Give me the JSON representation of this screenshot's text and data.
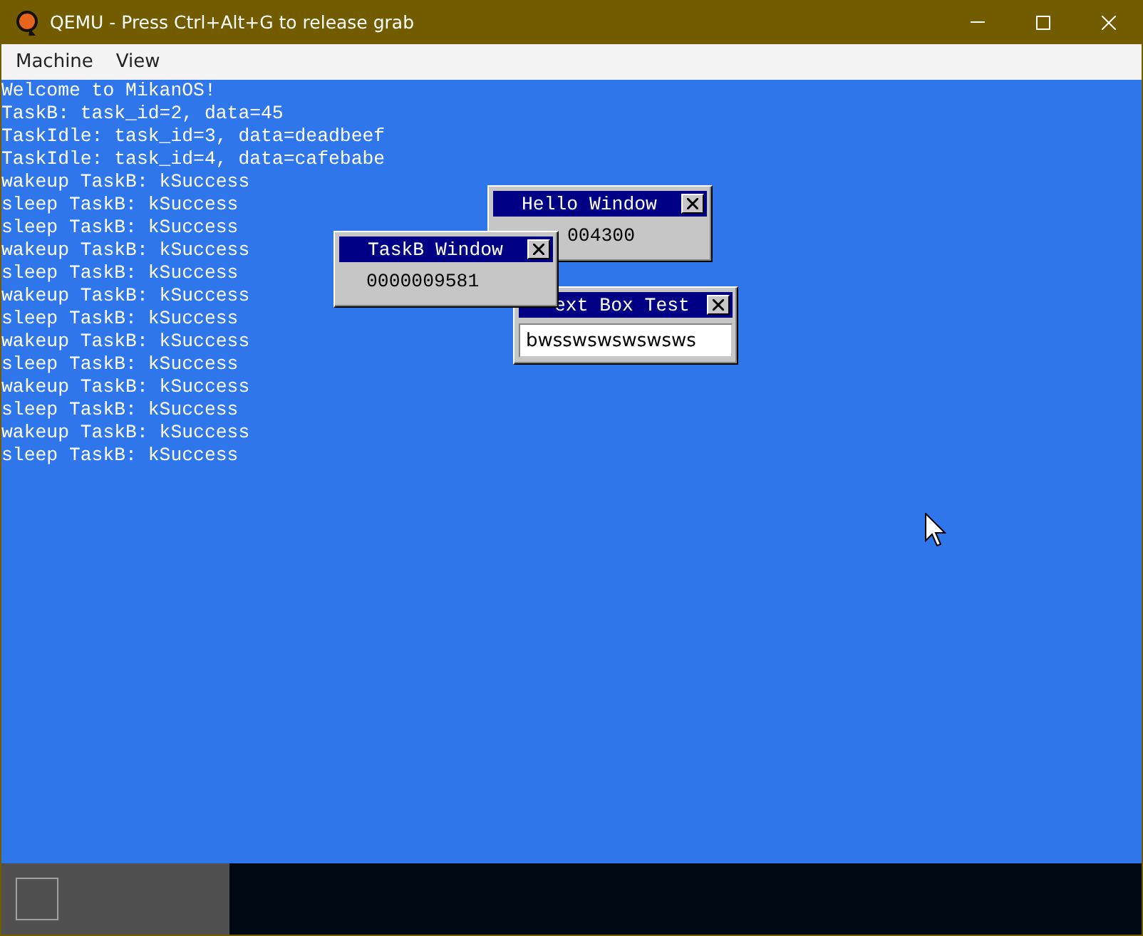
{
  "window": {
    "title": "QEMU - Press Ctrl+Alt+G to release grab"
  },
  "menu": [
    "Machine",
    "View"
  ],
  "console": [
    "Welcome to MikanOS!",
    "TaskB: task_id=2, data=45",
    "TaskIdle: task_id=3, data=deadbeef",
    "TaskIdle: task_id=4, data=cafebabe",
    "wakeup TaskB: kSuccess",
    "sleep TaskB: kSuccess",
    "sleep TaskB: kSuccess",
    "wakeup TaskB: kSuccess",
    "sleep TaskB: kSuccess",
    "wakeup TaskB: kSuccess",
    "sleep TaskB: kSuccess",
    "wakeup TaskB: kSuccess",
    "sleep TaskB: kSuccess",
    "wakeup TaskB: kSuccess",
    "sleep TaskB: kSuccess",
    "wakeup TaskB: kSuccess",
    "sleep TaskB: kSuccess"
  ],
  "os_windows": [
    {
      "kind": "counter",
      "title": "Hello Window",
      "value": "004300"
    },
    {
      "kind": "textbox",
      "title": "ext Box Test",
      "value": "bwsswswswswsws"
    },
    {
      "kind": "counter",
      "title": "TaskB Window",
      "value": "0000009581"
    }
  ]
}
